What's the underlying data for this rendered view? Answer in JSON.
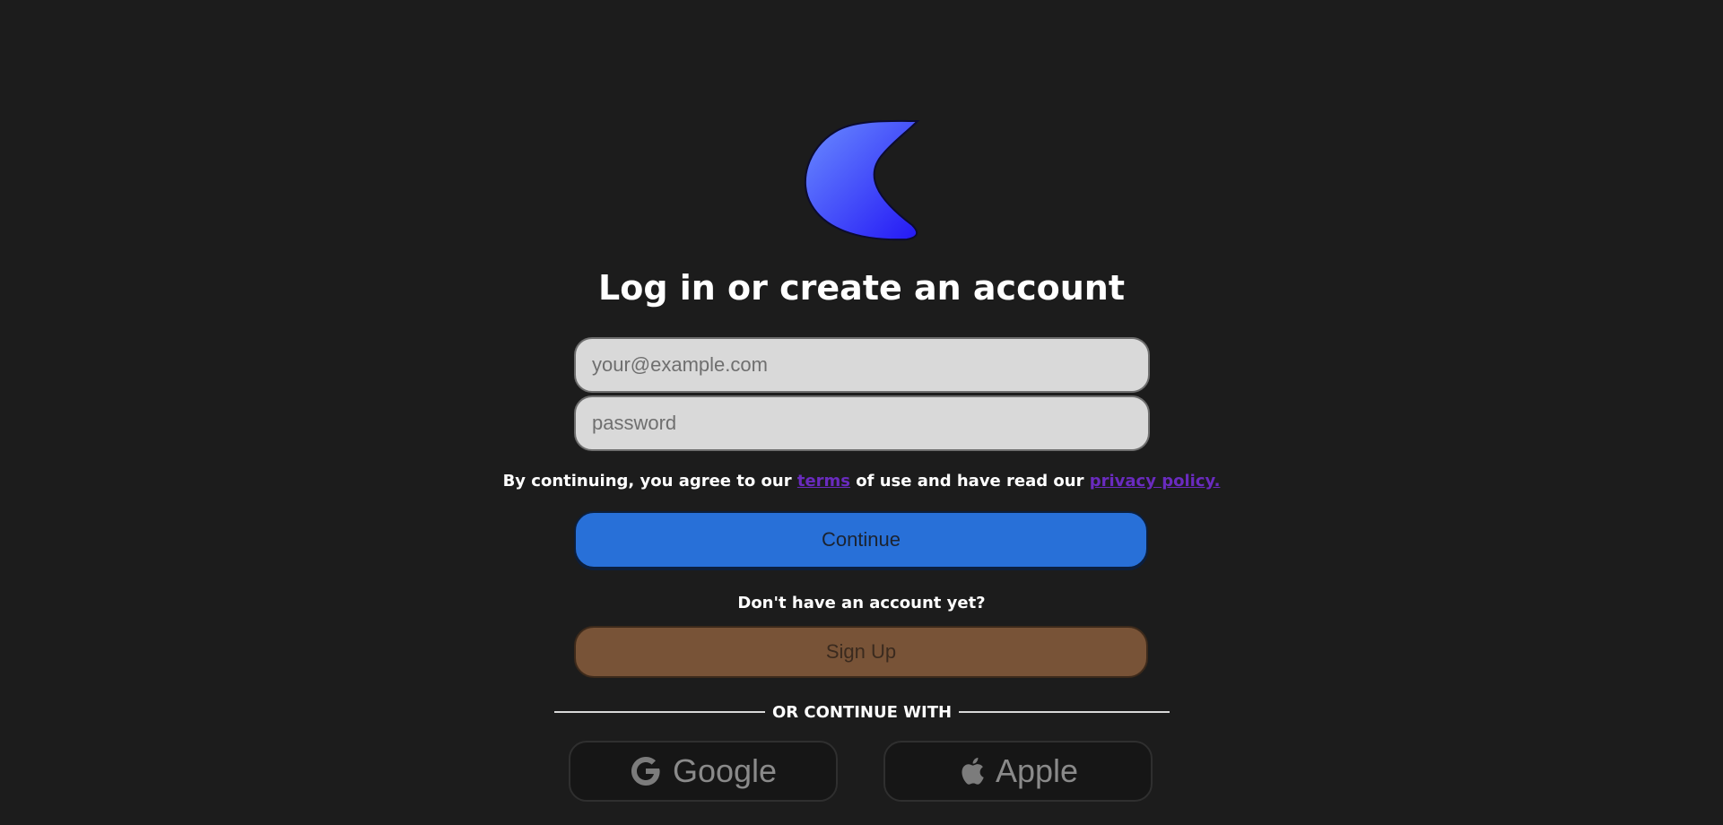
{
  "logo": {
    "icon": "crescent-moon-logo",
    "gradient_top": "#6a8cff",
    "gradient_bottom": "#2418f5"
  },
  "heading": "Log in or create an account",
  "form": {
    "email_placeholder": "your@example.com",
    "password_placeholder": "password"
  },
  "consent": {
    "prefix": "By continuing, you agree to our ",
    "terms_link": "terms",
    "middle": " of use and have read our ",
    "privacy_link": "privacy policy."
  },
  "continue_label": "Continue",
  "no_account_text": "Don't have an account yet?",
  "signup_label": "Sign Up",
  "divider_text": "OR CONTINUE WITH",
  "social": {
    "google_label": "Google",
    "apple_label": "Apple"
  },
  "colors": {
    "background": "#1c1c1c",
    "continue": "#2870d8",
    "signup": "#785337",
    "link": "#6a2bbf"
  }
}
